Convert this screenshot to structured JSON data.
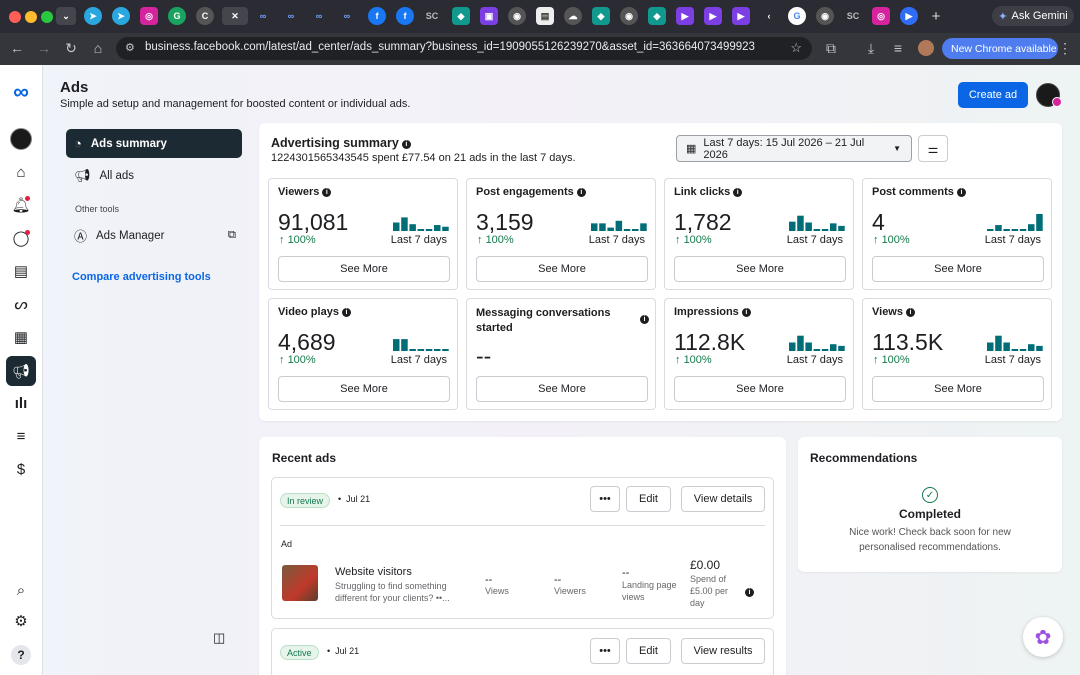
{
  "browser": {
    "tab_labels": [
      "SC",
      "SC"
    ],
    "ask_gemini": "Ask Gemini",
    "url": "business.facebook.com/latest/ad_center/ads_summary?business_id=1909055126239270&asset_id=363664073499923",
    "new_chrome": "New Chrome available"
  },
  "header": {
    "title": "Ads",
    "subtitle": "Simple ad setup and management for boosted content or individual ads.",
    "create_ad": "Create ad"
  },
  "sidebar": {
    "items": [
      {
        "label": "Ads summary"
      },
      {
        "label": "All ads"
      }
    ],
    "other_tools_label": "Other tools",
    "ads_manager": "Ads Manager",
    "compare": "Compare advertising tools"
  },
  "summary": {
    "title": "Advertising summary",
    "spend_text": "1224301565343545 spent £77.54 on 21 ads in the last 7 days.",
    "date_range": "Last 7 days: 15 Jul 2026 – 21 Jul 2026"
  },
  "metrics": [
    {
      "title": "Viewers",
      "value": "91,081",
      "pct": "100%",
      "period": "Last 7 days",
      "see_more": "See More",
      "bars": [
        0.5,
        0.8,
        0.4,
        0.1,
        0.1,
        0.35,
        0.25
      ]
    },
    {
      "title": "Post engagements",
      "value": "3,159",
      "pct": "100%",
      "period": "Last 7 days",
      "see_more": "See More",
      "bars": [
        0.45,
        0.45,
        0.2,
        0.6,
        0.1,
        0.1,
        0.45
      ]
    },
    {
      "title": "Link clicks",
      "value": "1,782",
      "pct": "100%",
      "period": "Last 7 days",
      "see_more": "See More",
      "bars": [
        0.55,
        0.9,
        0.5,
        0.1,
        0.1,
        0.45,
        0.3
      ]
    },
    {
      "title": "Post comments",
      "value": "4",
      "pct": "100%",
      "period": "Last 7 days",
      "see_more": "See More",
      "bars": [
        0.1,
        0.35,
        0.1,
        0.1,
        0.1,
        0.4,
        1.0
      ]
    },
    {
      "title": "Video plays",
      "value": "4,689",
      "pct": "100%",
      "period": "Last 7 days",
      "see_more": "See More",
      "bars": [
        0.7,
        0.7,
        0.1,
        0.1,
        0.1,
        0.1,
        0.1
      ]
    },
    {
      "title": "Messaging conversations started",
      "value": "--",
      "pct": "",
      "period": "",
      "see_more": "See More",
      "bars": []
    },
    {
      "title": "Impressions",
      "value": "112.8K",
      "pct": "100%",
      "period": "Last 7 days",
      "see_more": "See More",
      "bars": [
        0.5,
        0.9,
        0.5,
        0.1,
        0.1,
        0.4,
        0.3
      ]
    },
    {
      "title": "Views",
      "value": "113.5K",
      "pct": "100%",
      "period": "Last 7 days",
      "see_more": "See More",
      "bars": [
        0.5,
        0.9,
        0.5,
        0.1,
        0.1,
        0.4,
        0.3
      ]
    }
  ],
  "recent_ads": {
    "title": "Recent ads",
    "ads": [
      {
        "status": "In review",
        "date": "Jul 21",
        "col_label": "Ad",
        "name": "Website visitors",
        "desc": "Struggling to find something different for your clients? ••...",
        "views_val": "--",
        "views_lbl": "Views",
        "viewers_val": "--",
        "viewers_lbl": "Viewers",
        "lp_val": "--",
        "lp_lbl": "Landing page views",
        "spend_val": "£0.00",
        "spend_lbl": "Spend of £5.00 per day",
        "more": "•••",
        "edit": "Edit",
        "action": "View details"
      },
      {
        "status": "Active",
        "date": "Jul 21",
        "more": "•••",
        "edit": "Edit",
        "action": "View results"
      }
    ]
  },
  "recommendations": {
    "title": "Recommendations",
    "status": "Completed",
    "message": "Nice work! Check back soon for new personalised recommendations."
  },
  "colors": {
    "accent": "#0a66e4",
    "teal": "#006d77",
    "positive": "#13794a",
    "selected_nav": "#1c2b33"
  }
}
